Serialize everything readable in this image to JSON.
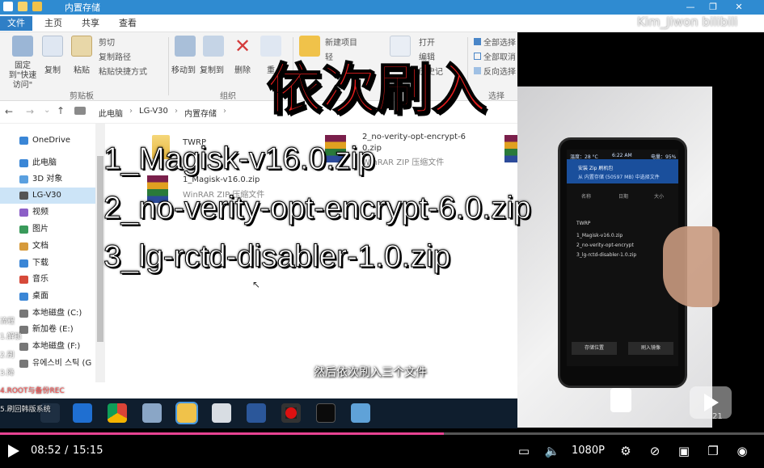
{
  "window": {
    "title": "内置存储",
    "watermark": "Kim_Jiwon bilibili"
  },
  "ribbon_tabs": [
    "文件",
    "主页",
    "共享",
    "查看"
  ],
  "ribbon": {
    "pin": "固定到\"快速访问\"",
    "copy": "复制",
    "paste": "粘贴",
    "cut": "剪切",
    "copy_path": "复制路径",
    "paste_shortcut": "粘贴快捷方式",
    "clipboard_group": "剪贴板",
    "move_to": "移动到",
    "copy_to": "复制到",
    "delete": "删除",
    "rename": "重",
    "organize_group": "组织",
    "new_item": "新建项目",
    "easy_access": "轻",
    "open": "打开",
    "edit": "编辑",
    "history": "历史记",
    "select_all": "全部选择",
    "select_none": "全部取消",
    "invert": "反向选择",
    "select_group": "选择"
  },
  "breadcrumb": [
    "此电脑",
    "LG-V30",
    "内置存储"
  ],
  "nav": [
    {
      "label": "OneDrive",
      "color": "#3a86d6"
    },
    {
      "label": "此电脑",
      "color": "#3a86d6"
    },
    {
      "label": "3D 对象",
      "color": "#5aa0e0"
    },
    {
      "label": "LG-V30",
      "color": "#555"
    },
    {
      "label": "视频",
      "color": "#8c5fc7"
    },
    {
      "label": "图片",
      "color": "#3a9a5b"
    },
    {
      "label": "文档",
      "color": "#d69a3a"
    },
    {
      "label": "下载",
      "color": "#3a86d6"
    },
    {
      "label": "音乐",
      "color": "#d64a3a"
    },
    {
      "label": "桌面",
      "color": "#3a86d6"
    },
    {
      "label": "本地磁盘 (C:)",
      "color": "#777"
    },
    {
      "label": "新加卷 (E:)",
      "color": "#777"
    },
    {
      "label": "本地磁盘 (F:)",
      "color": "#777"
    },
    {
      "label": "유에스비 스틱 (G",
      "color": "#777"
    }
  ],
  "files": [
    {
      "name": "TWRP",
      "sub": ""
    },
    {
      "name": "2_no-verity-opt-encrypt-6",
      "name2": "0.zip",
      "sub": "WinRAR ZIP 压缩文件"
    },
    {
      "name": "1_Magisk-v16.0.zip",
      "sub": "WinRAR ZIP 压缩文件"
    }
  ],
  "overlay": {
    "headline": "依次刷入",
    "lines": [
      "1_Magisk-v16.0.zip",
      "2_no-verity-opt-encrypt-6.0.zip",
      "3_lg-rctd-disabler-1.0.zip"
    ],
    "subtitle": "然后依次刷入三个文件"
  },
  "toc": [
    "流程",
    "1.解锁",
    "2.刷",
    "3.降",
    "4.ROOT与备份REC",
    "5.刷回韩版系统"
  ],
  "phone": {
    "status_left": "温度：28 °C",
    "status_mid": "6:22 AM",
    "status_right": "电量：95%",
    "header_title": "安装 Zip 刷机包",
    "header_sub": "从 内置存储 (50597 MB) 中选择文件",
    "tabs": [
      "名称",
      "日期",
      "大小"
    ],
    "folders": [
      "TWRP"
    ],
    "file_list": [
      "1_Magisk-v16.0.zip",
      "2_no-verity-opt-encrypt",
      "3_lg-rctd-disabler-1.0.zip"
    ],
    "btn_storage": "存储位置",
    "btn_flash": "刷入镜像"
  },
  "player": {
    "current": "08:52",
    "total": "15:15",
    "progress": 0.581,
    "quality": "1080P",
    "mini_label": "21"
  }
}
